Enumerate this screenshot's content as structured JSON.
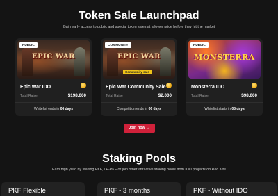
{
  "launchpad": {
    "title": "Token Sale Launchpad",
    "subtitle": "Gain early access to public and special token sales at a lower price before they hit the market"
  },
  "cards": [
    {
      "badge": "PUBLIC",
      "logo": "EPIC WAR",
      "name": "Epic War IDO",
      "raised_label": "Total Raise",
      "raised_value": "$198,000",
      "status_prefix": "Whitelist ends in ",
      "status_highlight": "06 days"
    },
    {
      "badge": "COMMUNITY",
      "logo": "EPIC WAR",
      "sub_tag": "Community sale",
      "name": "Epic War Community Sale",
      "raised_label": "Total Raise",
      "raised_value": "$2,000",
      "status_prefix": "Competition ends in ",
      "status_highlight": "06 days"
    },
    {
      "badge": "PUBLIC",
      "logo": "MONSTERRA",
      "name": "Monsterra IDO",
      "raised_label": "Total Raise",
      "raised_value": "$98,000",
      "status_prefix": "Whitelist starts in ",
      "status_highlight": "08 days"
    }
  ],
  "join_button": "Join now →",
  "staking": {
    "title": "Staking Pools",
    "subtitle": "Earn high yield by staking PKF, LP-PKF or join other attractive staking pools from IDO projects on Red Kite"
  },
  "pools": [
    {
      "name": "PKF Flexible"
    },
    {
      "name": "PKF - 3 months"
    },
    {
      "name": "PKF - Without IDO"
    }
  ],
  "colors": {
    "background": "#141414",
    "card": "#202020",
    "accent": "#d0213a",
    "coin": "#f2b01b"
  },
  "icons": {
    "coin": "coin-icon",
    "arrow": "arrow-right-icon"
  }
}
